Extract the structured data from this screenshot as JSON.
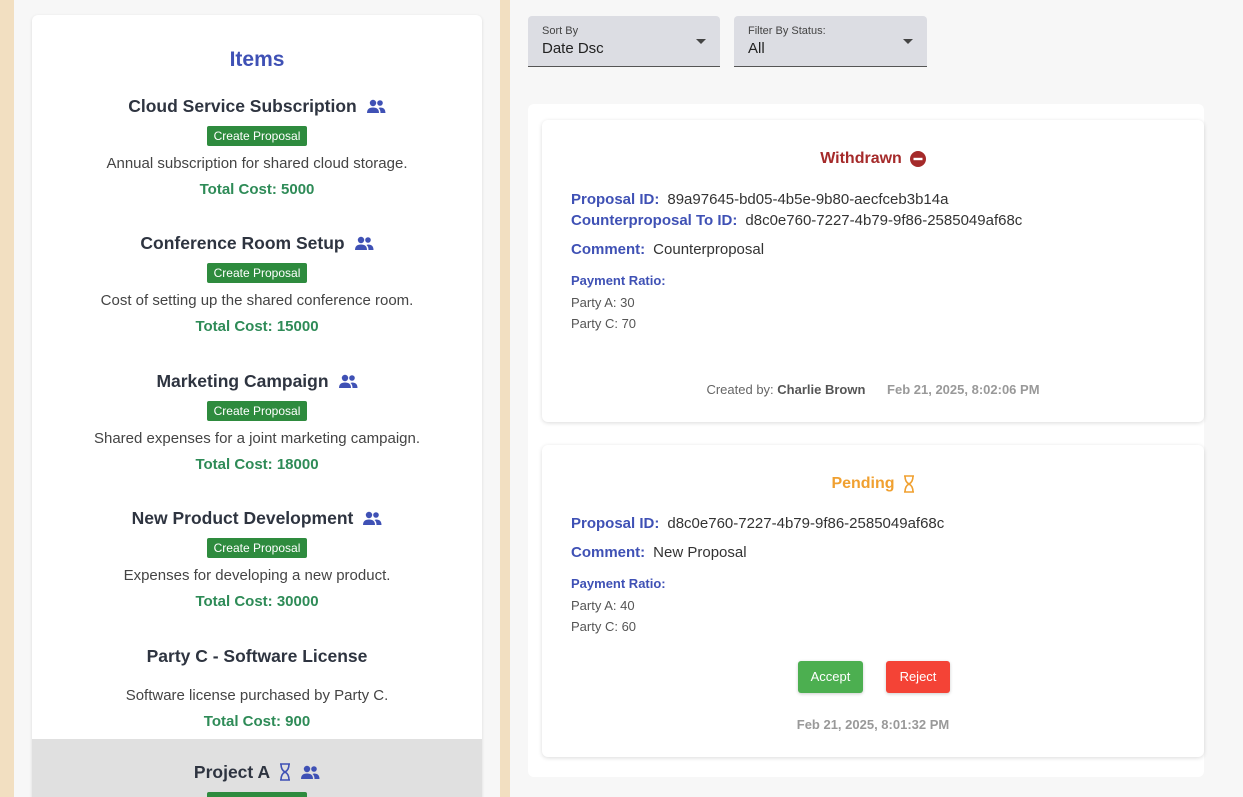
{
  "items_panel": {
    "title": "Items",
    "create_label": "Create Proposal",
    "items": [
      {
        "name": "Cloud Service Subscription",
        "shared": true,
        "has_create": true,
        "description": "Annual subscription for shared cloud storage.",
        "cost": "Total Cost: 5000"
      },
      {
        "name": "Conference Room Setup",
        "shared": true,
        "has_create": true,
        "description": "Cost of setting up the shared conference room.",
        "cost": "Total Cost: 15000"
      },
      {
        "name": "Marketing Campaign",
        "shared": true,
        "has_create": true,
        "description": "Shared expenses for a joint marketing campaign.",
        "cost": "Total Cost: 18000"
      },
      {
        "name": "New Product Development",
        "shared": true,
        "has_create": true,
        "description": "Expenses for developing a new product.",
        "cost": "Total Cost: 30000"
      },
      {
        "name": "Party C - Software License",
        "shared": false,
        "has_create": false,
        "description": "Software license purchased by Party C.",
        "cost": "Total Cost: 900"
      },
      {
        "name": "Project A",
        "shared": true,
        "pending": true,
        "has_create": true,
        "description": "",
        "cost": ""
      }
    ]
  },
  "filters": {
    "sort": {
      "label": "Sort By",
      "value": "Date Dsc"
    },
    "status": {
      "label": "Filter By Status:",
      "value": "All"
    }
  },
  "proposals": [
    {
      "status": "Withdrawn",
      "status_color": "#a52a2a",
      "status_icon": "minus-circle-icon",
      "proposal_id_label": "Proposal ID:",
      "proposal_id": "89a97645-bd05-4b5e-9b80-aecfceb3b14a",
      "counter_label": "Counterproposal To ID:",
      "counter_id": "d8c0e760-7227-4b79-9f86-2585049af68c",
      "comment_label": "Comment:",
      "comment": "Counterproposal",
      "ratio_label": "Payment Ratio:",
      "ratios": [
        "Party A: 30",
        "Party C: 70"
      ],
      "created_by_label": "Created by:",
      "created_by": "Charlie Brown",
      "date": "Feb 21, 2025, 8:02:06 PM"
    },
    {
      "status": "Pending",
      "status_color": "#f0a030",
      "status_icon": "hourglass-icon",
      "proposal_id_label": "Proposal ID:",
      "proposal_id": "d8c0e760-7227-4b79-9f86-2585049af68c",
      "comment_label": "Comment:",
      "comment": "New Proposal",
      "ratio_label": "Payment Ratio:",
      "ratios": [
        "Party A: 40",
        "Party C: 60"
      ],
      "accept_label": "Accept",
      "reject_label": "Reject",
      "date": "Feb 21, 2025, 8:01:32 PM"
    }
  ],
  "colors": {
    "accent": "#3f51b5",
    "create_button": "#2e8b3e",
    "cost_text": "#2e8b57",
    "accept": "#4caf50",
    "reject": "#f44336",
    "page_bg": "#f2dfc1"
  }
}
